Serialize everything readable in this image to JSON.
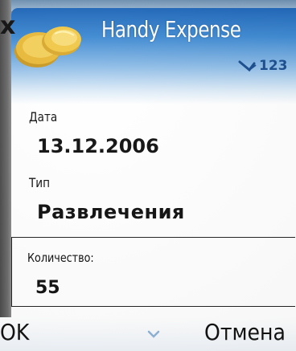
{
  "app": {
    "title": "Handy Expense",
    "close_symbol": "x",
    "input_mode": "123",
    "icons": [
      "coin-icon",
      "pen-icon",
      "close-icon",
      "scroll-down-icon"
    ]
  },
  "form": {
    "date_label": "Дата",
    "date_value": "13.12.2006",
    "type_label": "Тип",
    "type_value": "Развлечения",
    "amount_label": "Количество:",
    "amount_value": "55"
  },
  "softkeys": {
    "left": "OK",
    "right": "Отмена"
  },
  "colors": {
    "header_blue": "#1f66b8",
    "title_text": "#ffffff",
    "indicator": "#1a4d8f",
    "coin_gold": "#e8b93a"
  }
}
